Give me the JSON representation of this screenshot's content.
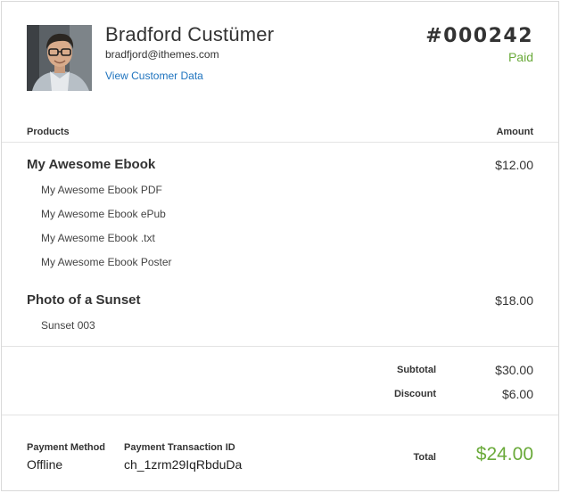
{
  "customer": {
    "name": "Bradford Custümer",
    "email": "bradfjord@ithemes.com",
    "link_label": "View Customer Data"
  },
  "order": {
    "number": "#000242",
    "status": "Paid"
  },
  "table": {
    "products_header": "Products",
    "amount_header": "Amount"
  },
  "products": [
    {
      "title": "My Awesome Ebook",
      "price": "$12.00",
      "files": [
        "My Awesome Ebook PDF",
        "My Awesome Ebook ePub",
        "My Awesome Ebook .txt",
        "My Awesome Ebook Poster"
      ]
    },
    {
      "title": "Photo of a Sunset",
      "price": "$18.00",
      "files": [
        "Sunset 003"
      ]
    }
  ],
  "summary": {
    "subtotal_label": "Subtotal",
    "subtotal_value": "$30.00",
    "discount_label": "Discount",
    "discount_value": "$6.00"
  },
  "payment": {
    "method_label": "Payment Method",
    "method_value": "Offline",
    "txn_label": "Payment Transaction ID",
    "txn_value": "ch_1zrm29IqRbduDa",
    "total_label": "Total",
    "total_value": "$24.00"
  },
  "colors": {
    "accent_green": "#6aaa3a",
    "link_blue": "#1e73be"
  }
}
